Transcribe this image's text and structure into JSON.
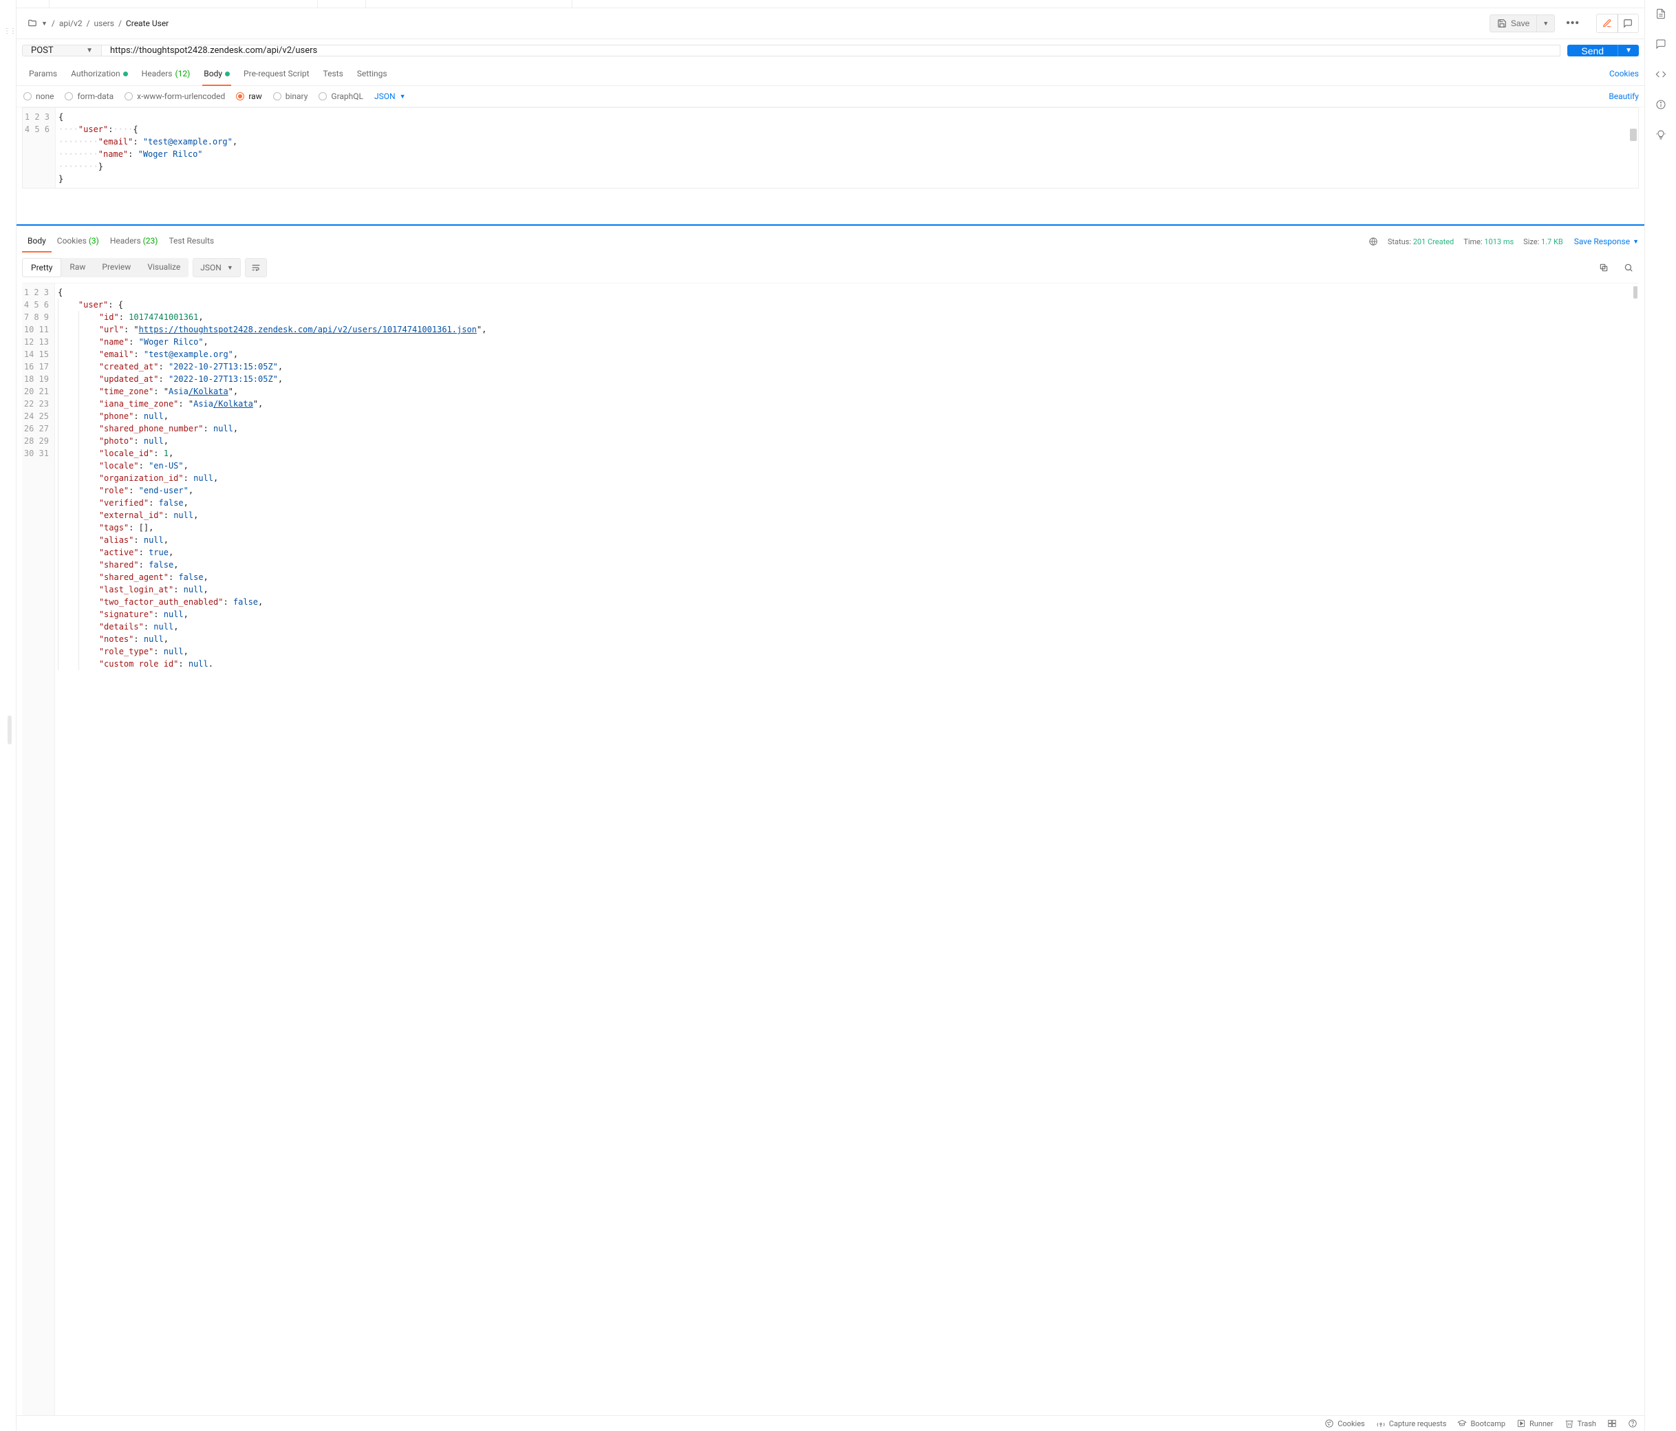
{
  "breadcrumb": {
    "seg1": "api/v2",
    "seg2": "users",
    "current": "Create User"
  },
  "actions": {
    "save": "Save"
  },
  "request": {
    "method": "POST",
    "url": "https://thoughtspot2428.zendesk.com/api/v2/users",
    "send": "Send"
  },
  "reqTabs": {
    "params": "Params",
    "auth": "Authorization",
    "headers": "Headers",
    "headersCount": "(12)",
    "body": "Body",
    "prereq": "Pre-request Script",
    "tests": "Tests",
    "settings": "Settings",
    "cookies": "Cookies"
  },
  "bodyTypes": {
    "none": "none",
    "formdata": "form-data",
    "xwww": "x-www-form-urlencoded",
    "raw": "raw",
    "binary": "binary",
    "graphql": "GraphQL",
    "lang": "JSON",
    "beautify": "Beautify"
  },
  "reqBodyLines": [
    [
      [
        "punc",
        "{"
      ]
    ],
    [
      [
        "ws",
        "····"
      ],
      [
        "key",
        "\"user\""
      ],
      [
        "punc",
        ":"
      ],
      [
        "ws",
        "····"
      ],
      [
        "punc",
        "{"
      ]
    ],
    [
      [
        "ws",
        "········"
      ],
      [
        "key",
        "\"email\""
      ],
      [
        "punc",
        ": "
      ],
      [
        "str",
        "\"test@example.org\""
      ],
      [
        "punc",
        ","
      ]
    ],
    [
      [
        "ws",
        "········"
      ],
      [
        "key",
        "\"name\""
      ],
      [
        "punc",
        ": "
      ],
      [
        "str",
        "\"Woger Rilco\""
      ]
    ],
    [
      [
        "ws",
        "········"
      ],
      [
        "punc",
        "}"
      ]
    ],
    [
      [
        "punc",
        "}"
      ]
    ]
  ],
  "response": {
    "tabs": {
      "body": "Body",
      "cookies": "Cookies",
      "cookiesCount": "(3)",
      "headers": "Headers",
      "headersCount": "(23)",
      "test": "Test Results"
    },
    "statusLabel": "Status:",
    "statusVal": "201 Created",
    "timeLabel": "Time:",
    "timeVal": "1013 ms",
    "sizeLabel": "Size:",
    "sizeVal": "1.7 KB",
    "saveResponse": "Save Response",
    "views": {
      "pretty": "Pretty",
      "raw": "Raw",
      "preview": "Preview",
      "visualize": "Visualize"
    },
    "lang": "JSON"
  },
  "respLines": [
    [
      [
        "punc",
        "{"
      ]
    ],
    [
      [
        "g",
        1
      ],
      [
        "key",
        "\"user\""
      ],
      [
        "punc",
        ": "
      ],
      [
        "punc",
        "{"
      ]
    ],
    [
      [
        "g",
        2
      ],
      [
        "key",
        "\"id\""
      ],
      [
        "punc",
        ": "
      ],
      [
        "num",
        "10174741001361"
      ],
      [
        "punc",
        ","
      ]
    ],
    [
      [
        "g",
        2
      ],
      [
        "key",
        "\"url\""
      ],
      [
        "punc",
        ": "
      ],
      [
        "punc",
        "\""
      ],
      [
        "link",
        "https://thoughtspot2428.zendesk.com/api/v2/users/10174741001361.json"
      ],
      [
        "punc",
        "\""
      ],
      [
        "punc",
        ","
      ]
    ],
    [
      [
        "g",
        2
      ],
      [
        "key",
        "\"name\""
      ],
      [
        "punc",
        ": "
      ],
      [
        "str",
        "\"Woger Rilco\""
      ],
      [
        "punc",
        ","
      ]
    ],
    [
      [
        "g",
        2
      ],
      [
        "key",
        "\"email\""
      ],
      [
        "punc",
        ": "
      ],
      [
        "str",
        "\"test@example.org\""
      ],
      [
        "punc",
        ","
      ]
    ],
    [
      [
        "g",
        2
      ],
      [
        "key",
        "\"created_at\""
      ],
      [
        "punc",
        ": "
      ],
      [
        "str",
        "\"2022-10-27T13:15:05Z\""
      ],
      [
        "punc",
        ","
      ]
    ],
    [
      [
        "g",
        2
      ],
      [
        "key",
        "\"updated_at\""
      ],
      [
        "punc",
        ": "
      ],
      [
        "str",
        "\"2022-10-27T13:15:05Z\""
      ],
      [
        "punc",
        ","
      ]
    ],
    [
      [
        "g",
        2
      ],
      [
        "key",
        "\"time_zone\""
      ],
      [
        "punc",
        ": "
      ],
      [
        "punc",
        "\""
      ],
      [
        "str2",
        "Asia"
      ],
      [
        "link",
        "/Kolkata"
      ],
      [
        "punc",
        "\""
      ],
      [
        "punc",
        ","
      ]
    ],
    [
      [
        "g",
        2
      ],
      [
        "key",
        "\"iana_time_zone\""
      ],
      [
        "punc",
        ": "
      ],
      [
        "punc",
        "\""
      ],
      [
        "str2",
        "Asia"
      ],
      [
        "link",
        "/Kolkata"
      ],
      [
        "punc",
        "\""
      ],
      [
        "punc",
        ","
      ]
    ],
    [
      [
        "g",
        2
      ],
      [
        "key",
        "\"phone\""
      ],
      [
        "punc",
        ": "
      ],
      [
        "null",
        "null"
      ],
      [
        "punc",
        ","
      ]
    ],
    [
      [
        "g",
        2
      ],
      [
        "key",
        "\"shared_phone_number\""
      ],
      [
        "punc",
        ": "
      ],
      [
        "null",
        "null"
      ],
      [
        "punc",
        ","
      ]
    ],
    [
      [
        "g",
        2
      ],
      [
        "key",
        "\"photo\""
      ],
      [
        "punc",
        ": "
      ],
      [
        "null",
        "null"
      ],
      [
        "punc",
        ","
      ]
    ],
    [
      [
        "g",
        2
      ],
      [
        "key",
        "\"locale_id\""
      ],
      [
        "punc",
        ": "
      ],
      [
        "num",
        "1"
      ],
      [
        "punc",
        ","
      ]
    ],
    [
      [
        "g",
        2
      ],
      [
        "key",
        "\"locale\""
      ],
      [
        "punc",
        ": "
      ],
      [
        "str",
        "\"en-US\""
      ],
      [
        "punc",
        ","
      ]
    ],
    [
      [
        "g",
        2
      ],
      [
        "key",
        "\"organization_id\""
      ],
      [
        "punc",
        ": "
      ],
      [
        "null",
        "null"
      ],
      [
        "punc",
        ","
      ]
    ],
    [
      [
        "g",
        2
      ],
      [
        "key",
        "\"role\""
      ],
      [
        "punc",
        ": "
      ],
      [
        "str",
        "\"end-user\""
      ],
      [
        "punc",
        ","
      ]
    ],
    [
      [
        "g",
        2
      ],
      [
        "key",
        "\"verified\""
      ],
      [
        "punc",
        ": "
      ],
      [
        "bool",
        "false"
      ],
      [
        "punc",
        ","
      ]
    ],
    [
      [
        "g",
        2
      ],
      [
        "key",
        "\"external_id\""
      ],
      [
        "punc",
        ": "
      ],
      [
        "null",
        "null"
      ],
      [
        "punc",
        ","
      ]
    ],
    [
      [
        "g",
        2
      ],
      [
        "key",
        "\"tags\""
      ],
      [
        "punc",
        ": "
      ],
      [
        "punc",
        "[]"
      ],
      [
        "punc",
        ","
      ]
    ],
    [
      [
        "g",
        2
      ],
      [
        "key",
        "\"alias\""
      ],
      [
        "punc",
        ": "
      ],
      [
        "null",
        "null"
      ],
      [
        "punc",
        ","
      ]
    ],
    [
      [
        "g",
        2
      ],
      [
        "key",
        "\"active\""
      ],
      [
        "punc",
        ": "
      ],
      [
        "bool",
        "true"
      ],
      [
        "punc",
        ","
      ]
    ],
    [
      [
        "g",
        2
      ],
      [
        "key",
        "\"shared\""
      ],
      [
        "punc",
        ": "
      ],
      [
        "bool",
        "false"
      ],
      [
        "punc",
        ","
      ]
    ],
    [
      [
        "g",
        2
      ],
      [
        "key",
        "\"shared_agent\""
      ],
      [
        "punc",
        ": "
      ],
      [
        "bool",
        "false"
      ],
      [
        "punc",
        ","
      ]
    ],
    [
      [
        "g",
        2
      ],
      [
        "key",
        "\"last_login_at\""
      ],
      [
        "punc",
        ": "
      ],
      [
        "null",
        "null"
      ],
      [
        "punc",
        ","
      ]
    ],
    [
      [
        "g",
        2
      ],
      [
        "key",
        "\"two_factor_auth_enabled\""
      ],
      [
        "punc",
        ": "
      ],
      [
        "bool",
        "false"
      ],
      [
        "punc",
        ","
      ]
    ],
    [
      [
        "g",
        2
      ],
      [
        "key",
        "\"signature\""
      ],
      [
        "punc",
        ": "
      ],
      [
        "null",
        "null"
      ],
      [
        "punc",
        ","
      ]
    ],
    [
      [
        "g",
        2
      ],
      [
        "key",
        "\"details\""
      ],
      [
        "punc",
        ": "
      ],
      [
        "null",
        "null"
      ],
      [
        "punc",
        ","
      ]
    ],
    [
      [
        "g",
        2
      ],
      [
        "key",
        "\"notes\""
      ],
      [
        "punc",
        ": "
      ],
      [
        "null",
        "null"
      ],
      [
        "punc",
        ","
      ]
    ],
    [
      [
        "g",
        2
      ],
      [
        "key",
        "\"role_type\""
      ],
      [
        "punc",
        ": "
      ],
      [
        "null",
        "null"
      ],
      [
        "punc",
        ","
      ]
    ],
    [
      [
        "g",
        2
      ],
      [
        "key",
        "\"custom role id\""
      ],
      [
        "punc",
        ": "
      ],
      [
        "null",
        "null"
      ],
      [
        "punc",
        "."
      ]
    ]
  ],
  "footer": {
    "cookies": "Cookies",
    "capture": "Capture requests",
    "bootcamp": "Bootcamp",
    "runner": "Runner",
    "trash": "Trash"
  }
}
